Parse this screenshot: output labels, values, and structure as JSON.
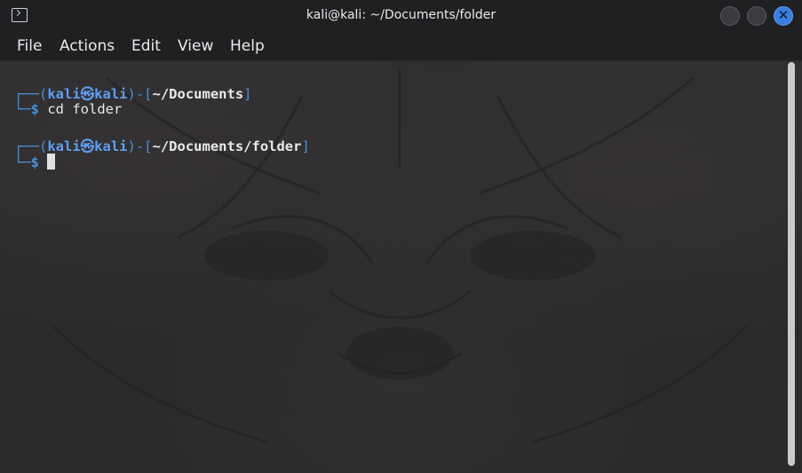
{
  "window": {
    "title": "kali@kali: ~/Documents/folder"
  },
  "menu": {
    "items": [
      "File",
      "Actions",
      "Edit",
      "View",
      "Help"
    ]
  },
  "terminal": {
    "prompt1": {
      "frame_open": "┌──(",
      "user": "kali",
      "at": "㉿",
      "host": "kali",
      "frame_mid": ")-[",
      "path": "~/Documents",
      "frame_close": "]",
      "corner": "└─",
      "dollar": "$",
      "command": " cd folder"
    },
    "prompt2": {
      "frame_open": "┌──(",
      "user": "kali",
      "at": "㉿",
      "host": "kali",
      "frame_mid": ")-[",
      "path": "~/Documents/folder",
      "frame_close": "]",
      "corner": "└─",
      "dollar": "$",
      "command": " "
    }
  },
  "colors": {
    "prompt_frame": "#4a8fd1",
    "prompt_user": "#5f9ef0",
    "text": "#e8eaec",
    "close_button": "#3a7ee0"
  },
  "icons": {
    "app": "terminal-icon",
    "close": "close-icon"
  }
}
